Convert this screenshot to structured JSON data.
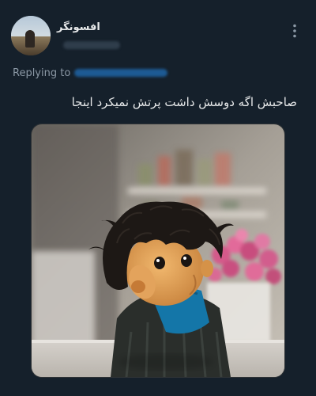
{
  "tweet": {
    "display_name": "افسونگر",
    "reply_prefix": "Replying to",
    "text": "صاحبش اگه دوسش داشت پرتش نمیکرد اینجا"
  },
  "icons": {
    "more": "more-vertical-icon",
    "avatar": "profile-avatar"
  },
  "colors": {
    "background": "#15202b",
    "text_primary": "#e7e9ea",
    "text_secondary": "#8b98a5",
    "link": "#1d9bf0"
  }
}
